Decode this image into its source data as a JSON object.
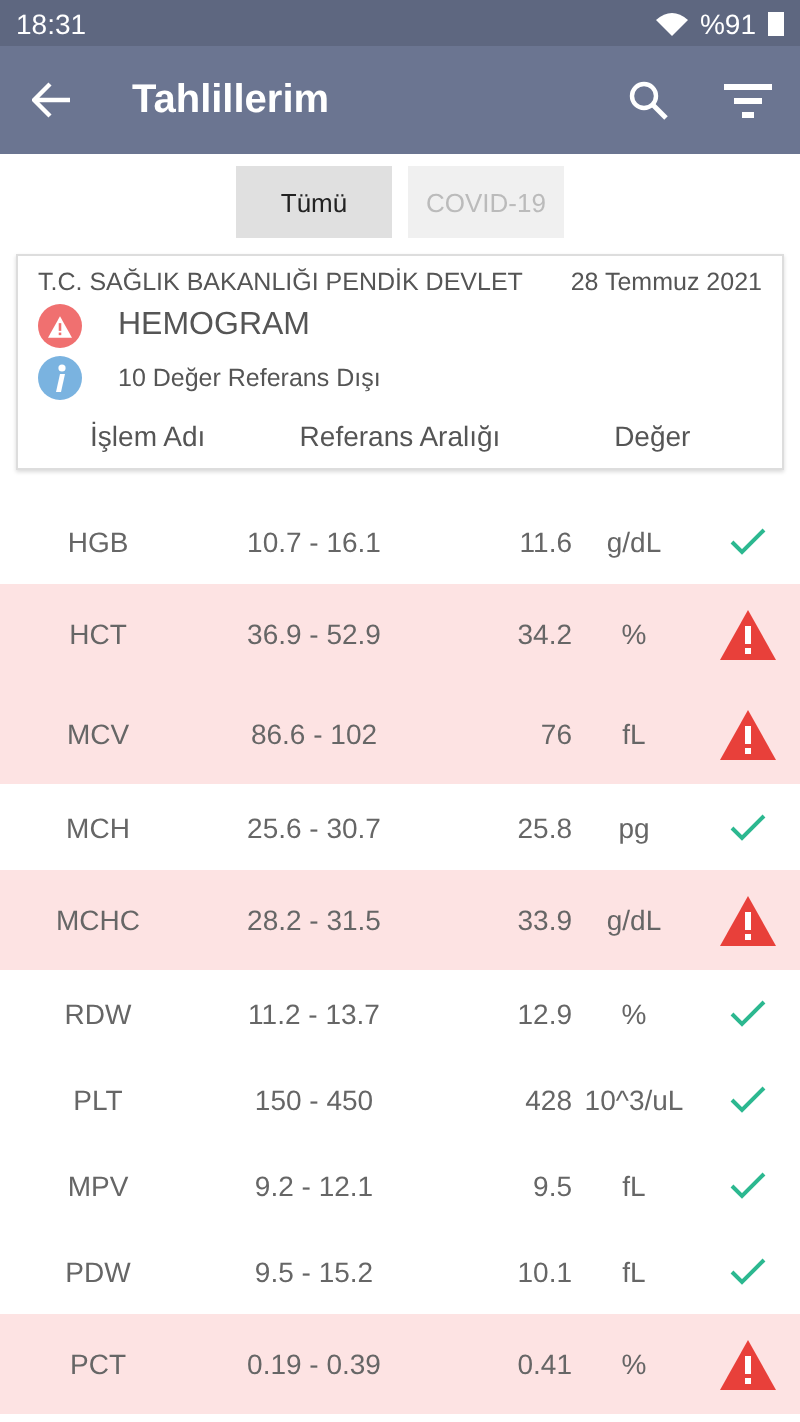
{
  "status_bar": {
    "time": "18:31",
    "battery": "%91"
  },
  "app_bar": {
    "title": "Tahlillerim"
  },
  "tabs": [
    {
      "label": "Tümü",
      "selected": true
    },
    {
      "label": "COVID-19",
      "selected": false
    }
  ],
  "card": {
    "institution": "T.C. SAĞLIK BAKANLIĞI PENDİK DEVLET",
    "date": "28 Temmuz 2021",
    "test": "HEMOGRAM",
    "note": "10 Değer Referans Dışı",
    "columns": [
      "İşlem Adı",
      "Referans Aralığı",
      "Değer"
    ]
  },
  "rows": [
    {
      "name": "HGB",
      "range": "10.7 - 16.1",
      "value": "11.6",
      "unit": "g/dL",
      "out_of_range": false
    },
    {
      "name": "HCT",
      "range": "36.9 - 52.9",
      "value": "34.2",
      "unit": "%",
      "out_of_range": true
    },
    {
      "name": "MCV",
      "range": "86.6 - 102",
      "value": "76",
      "unit": "fL",
      "out_of_range": true
    },
    {
      "name": "MCH",
      "range": "25.6 - 30.7",
      "value": "25.8",
      "unit": "pg",
      "out_of_range": false
    },
    {
      "name": "MCHC",
      "range": "28.2 - 31.5",
      "value": "33.9",
      "unit": "g/dL",
      "out_of_range": true
    },
    {
      "name": "RDW",
      "range": "11.2 - 13.7",
      "value": "12.9",
      "unit": "%",
      "out_of_range": false
    },
    {
      "name": "PLT",
      "range": "150 - 450",
      "value": "428",
      "unit": "10^3/uL",
      "out_of_range": false
    },
    {
      "name": "MPV",
      "range": "9.2 - 12.1",
      "value": "9.5",
      "unit": "fL",
      "out_of_range": false
    },
    {
      "name": "PDW",
      "range": "9.5 - 15.2",
      "value": "10.1",
      "unit": "fL",
      "out_of_range": false
    },
    {
      "name": "PCT",
      "range": "0.19 - 0.39",
      "value": "0.41",
      "unit": "%",
      "out_of_range": true
    }
  ]
}
